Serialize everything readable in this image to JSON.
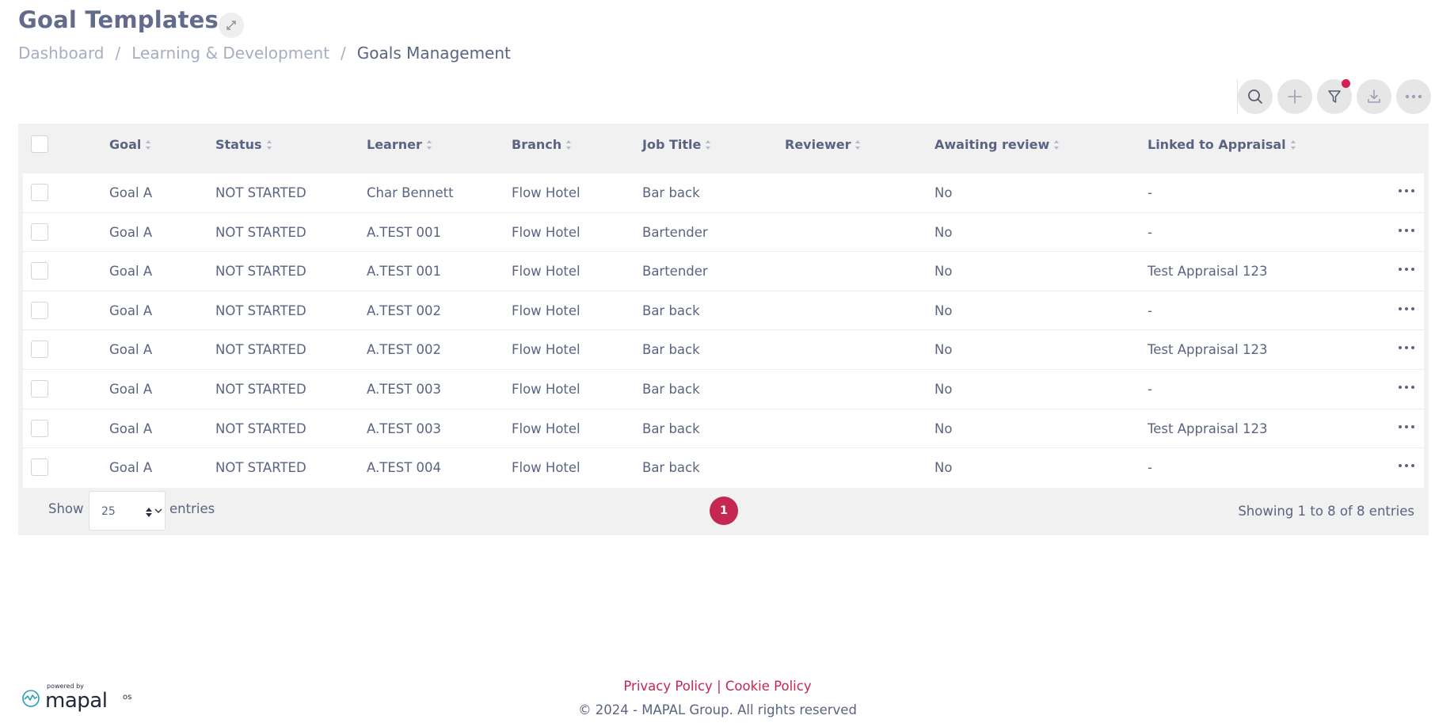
{
  "page": {
    "title": "Goal Templates"
  },
  "breadcrumb": {
    "items": [
      "Dashboard",
      "Learning & Development"
    ],
    "separator": "/",
    "current": "Goals Management"
  },
  "toolbar": {
    "buttons": [
      "search-icon",
      "plus-icon",
      "filter-icon",
      "download-icon",
      "more-icon"
    ],
    "filter_active_color": "#d0204f"
  },
  "table": {
    "columns": [
      "Goal",
      "Status",
      "Learner",
      "Branch",
      "Job Title",
      "Reviewer",
      "Awaiting review",
      "Linked to Appraisal"
    ],
    "rows": [
      {
        "goal": "Goal A",
        "status": "NOT STARTED",
        "learner": "Char Bennett",
        "branch": "Flow Hotel",
        "job_title": "Bar back",
        "reviewer": "",
        "awaiting_review": "No",
        "linked": "-"
      },
      {
        "goal": "Goal A",
        "status": "NOT STARTED",
        "learner": "A.TEST 001",
        "branch": "Flow Hotel",
        "job_title": "Bartender",
        "reviewer": "",
        "awaiting_review": "No",
        "linked": "-"
      },
      {
        "goal": "Goal A",
        "status": "NOT STARTED",
        "learner": "A.TEST 001",
        "branch": "Flow Hotel",
        "job_title": "Bartender",
        "reviewer": "",
        "awaiting_review": "No",
        "linked": "Test Appraisal 123"
      },
      {
        "goal": "Goal A",
        "status": "NOT STARTED",
        "learner": "A.TEST 002",
        "branch": "Flow Hotel",
        "job_title": "Bar back",
        "reviewer": "",
        "awaiting_review": "No",
        "linked": "-"
      },
      {
        "goal": "Goal A",
        "status": "NOT STARTED",
        "learner": "A.TEST 002",
        "branch": "Flow Hotel",
        "job_title": "Bar back",
        "reviewer": "",
        "awaiting_review": "No",
        "linked": "Test Appraisal 123"
      },
      {
        "goal": "Goal A",
        "status": "NOT STARTED",
        "learner": "A.TEST 003",
        "branch": "Flow Hotel",
        "job_title": "Bar back",
        "reviewer": "",
        "awaiting_review": "No",
        "linked": "-"
      },
      {
        "goal": "Goal A",
        "status": "NOT STARTED",
        "learner": "A.TEST 003",
        "branch": "Flow Hotel",
        "job_title": "Bar back",
        "reviewer": "",
        "awaiting_review": "No",
        "linked": "Test Appraisal 123"
      },
      {
        "goal": "Goal A",
        "status": "NOT STARTED",
        "learner": "A.TEST 004",
        "branch": "Flow Hotel",
        "job_title": "Bar back",
        "reviewer": "",
        "awaiting_review": "No",
        "linked": "-"
      }
    ]
  },
  "pagination": {
    "show_label": "Show",
    "page_size": "25",
    "entries_label": "entries",
    "current_page": "1",
    "summary": "Showing 1 to 8 of 8 entries"
  },
  "footer": {
    "links": [
      "Privacy Policy",
      "Cookie Policy"
    ],
    "link_separator": "|",
    "copyright": "© 2024 - MAPAL Group. All rights reserved",
    "logo": {
      "powered_by": "powered by",
      "brand": "mapal",
      "suffix": "os"
    }
  },
  "colors": {
    "accent": "#c62652",
    "text": "#5a6482",
    "muted": "#a7adc3",
    "table_bg": "#f1f1f1"
  }
}
